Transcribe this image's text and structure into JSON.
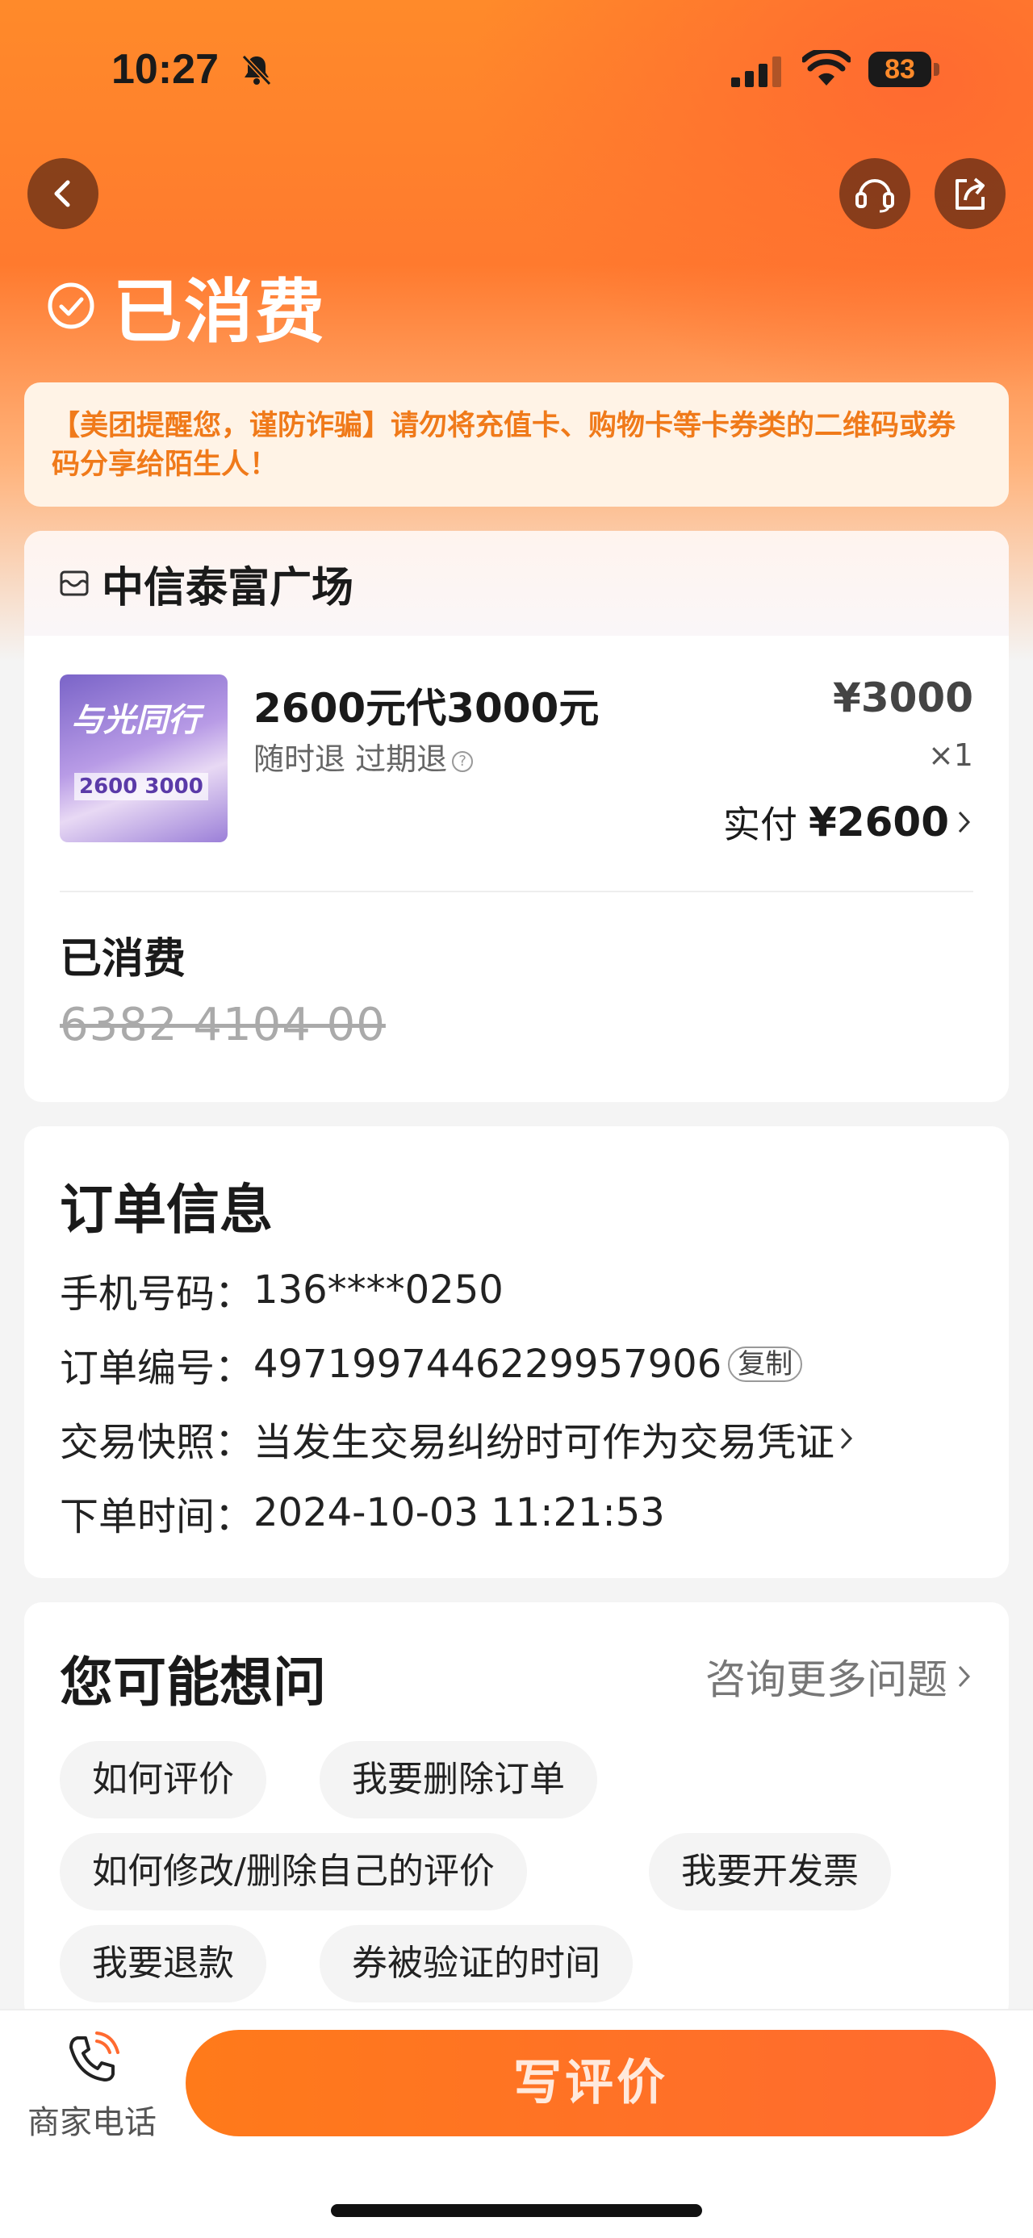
{
  "status_bar": {
    "time": "10:27",
    "battery": "83"
  },
  "header": {
    "status_title": "已消费"
  },
  "notice": {
    "text": "【美团提醒您，谨防诈骗】请勿将充值卡、购物卡等卡券类的二维码或券码分享给陌生人！"
  },
  "shop": {
    "name": "中信泰富广场",
    "product": {
      "image_text_main": "与光同行",
      "image_text_sub": "2600 3000",
      "title": "2600元代3000元",
      "subtitle": "随时退 过期退",
      "price": "¥3000",
      "quantity": "×1",
      "paid_label": "实付",
      "paid_value": "¥2600"
    },
    "consumed_label": "已消费",
    "voucher_code": "6382 4104 00"
  },
  "order": {
    "title": "订单信息",
    "rows": [
      {
        "key": "手机号码：",
        "value": "136****0250"
      },
      {
        "key": "订单编号：",
        "value": "4971997446229957906",
        "tag": "复制"
      },
      {
        "key": "交易快照：",
        "value": "当发生交易纠纷时可作为交易凭证"
      },
      {
        "key": "下单时间：",
        "value": "2024-10-03 11:21:53"
      }
    ]
  },
  "faq": {
    "title": "您可能想问",
    "more": "咨询更多问题",
    "chips": [
      "如何评价",
      "我要删除订单",
      "如何修改/删除自己的评价",
      "我要开发票",
      "我要退款",
      "券被验证的时间"
    ]
  },
  "bottom": {
    "phone_label": "商家电话",
    "review_button": "写评价"
  },
  "colors": {
    "accent": "#ff7a1a",
    "notice_text": "#f07a1a",
    "notice_bg": "#fff3e6"
  }
}
